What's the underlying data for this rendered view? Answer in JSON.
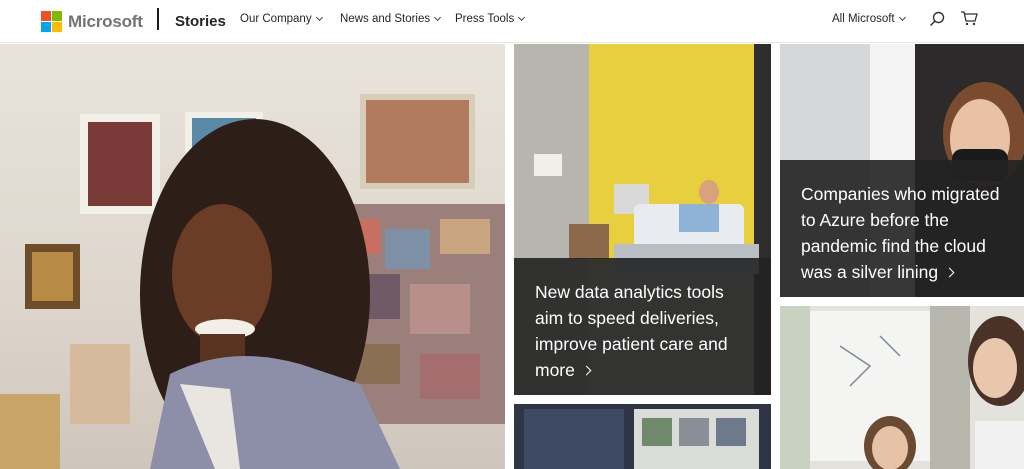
{
  "header": {
    "logo_text": "Microsoft",
    "logo_colors": [
      "#f25022",
      "#7fba00",
      "#00a4ef",
      "#ffb900"
    ],
    "section_title": "Stories",
    "nav": [
      {
        "label": "Our Company"
      },
      {
        "label": "News and Stories"
      },
      {
        "label": "Press Tools"
      }
    ],
    "all_microsoft": "All Microsoft",
    "icons": [
      "search-icon",
      "cart-icon"
    ]
  },
  "tiles": {
    "hospital": {
      "headline": "New data analytics tools aim to speed deliveries, improve patient care and more"
    },
    "azure": {
      "headline": "Companies who migrated to Azure before the pandemic find the cloud was a silver lining"
    }
  }
}
